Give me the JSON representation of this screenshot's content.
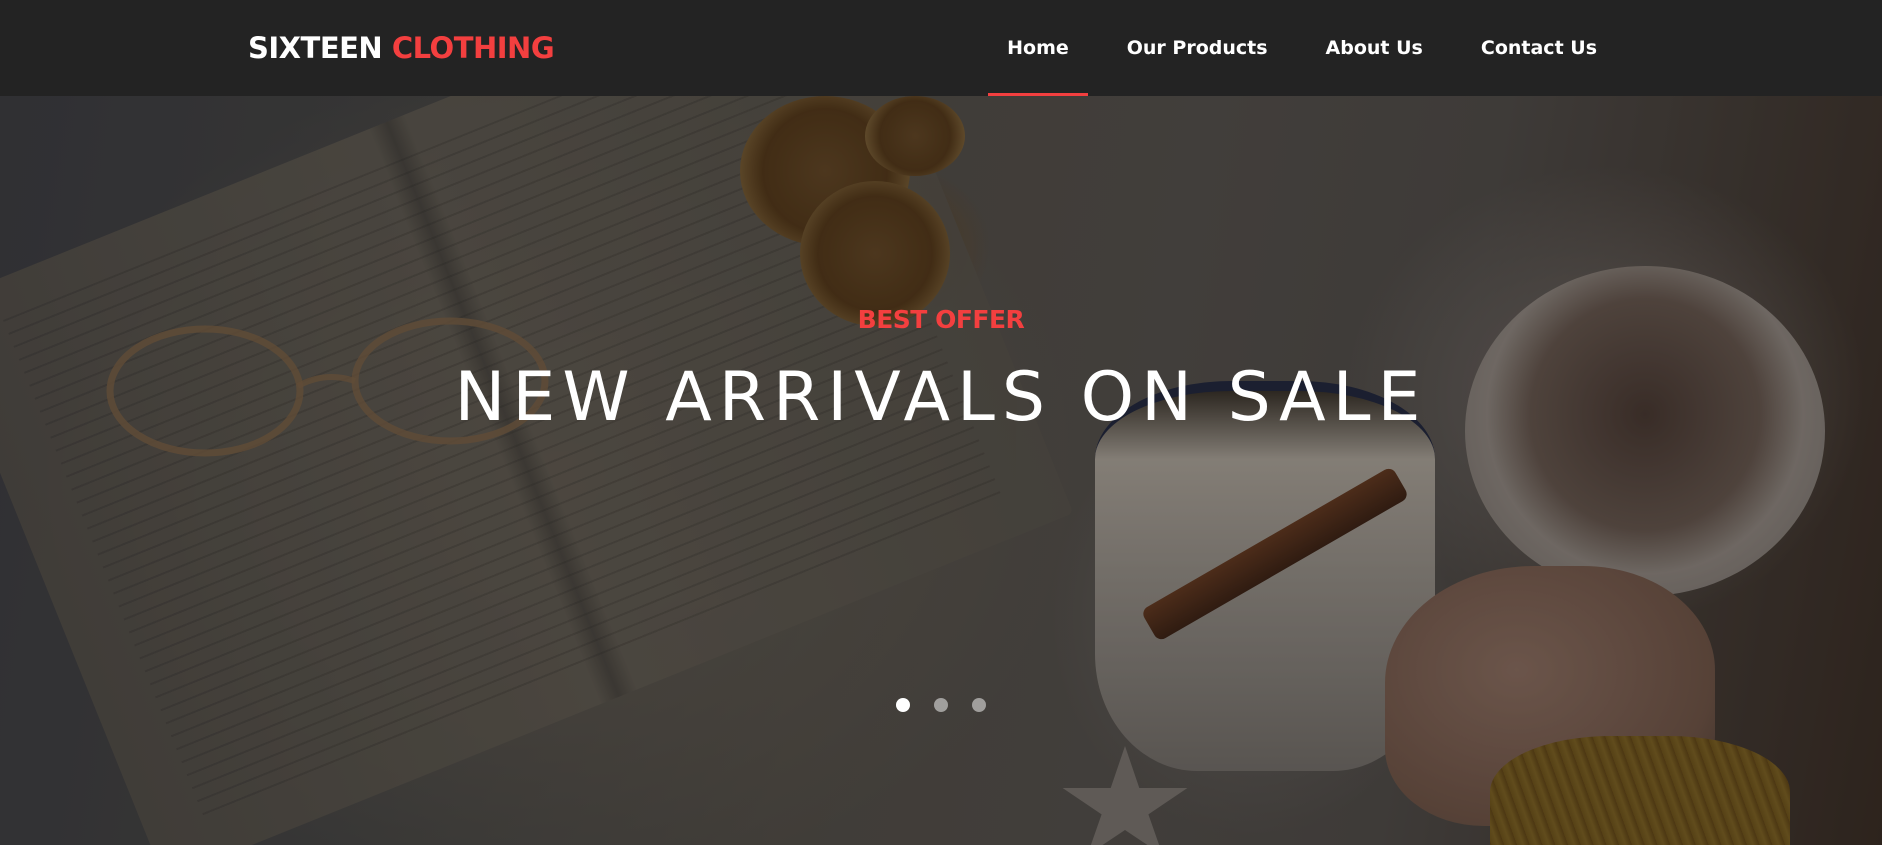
{
  "brand": {
    "name_part1": "SIXTEEN",
    "name_part2": "CLOTHING",
    "accent_color": "#f33f3f"
  },
  "nav": {
    "items": [
      {
        "label": "Home",
        "active": true
      },
      {
        "label": "Our Products",
        "active": false
      },
      {
        "label": "About Us",
        "active": false
      },
      {
        "label": "Contact Us",
        "active": false
      }
    ]
  },
  "hero": {
    "subtitle": "BEST OFFER",
    "title": "NEW ARRIVALS ON SALE",
    "slides_total": 3,
    "active_slide": 1
  },
  "colors": {
    "header_bg": "#232323",
    "accent": "#f33f3f",
    "text": "#ffffff"
  }
}
